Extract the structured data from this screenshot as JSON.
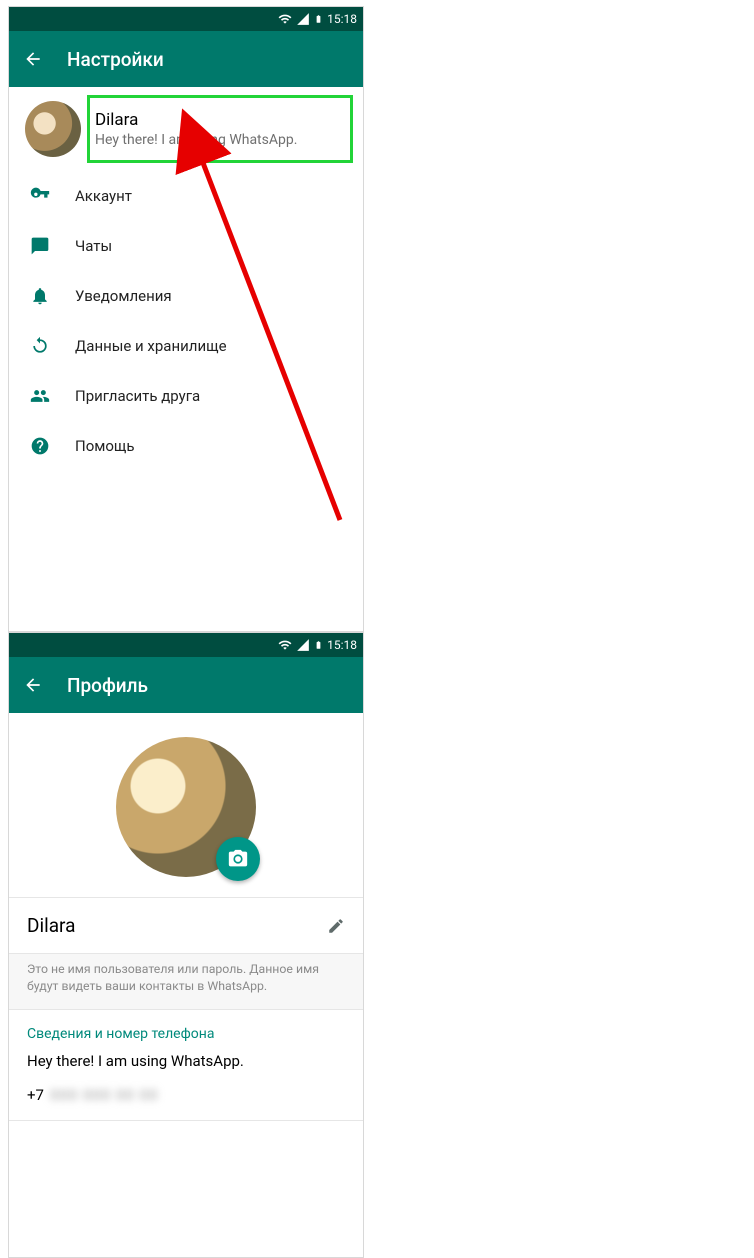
{
  "status": {
    "time": "15:18"
  },
  "left": {
    "title": "Настройки",
    "profile": {
      "name": "Dilara",
      "status": "Hey there! I am using WhatsApp."
    },
    "menu": [
      {
        "icon": "key-icon",
        "label": "Аккаунт"
      },
      {
        "icon": "chat-icon",
        "label": "Чаты"
      },
      {
        "icon": "bell-icon",
        "label": "Уведомления"
      },
      {
        "icon": "data-icon",
        "label": "Данные и хранилище"
      },
      {
        "icon": "invite-icon",
        "label": "Пригласить друга"
      },
      {
        "icon": "help-icon",
        "label": "Помощь"
      }
    ]
  },
  "right": {
    "title": "Профиль",
    "name": "Dilara",
    "hint": "Это не имя пользователя или пароль. Данное имя будут видеть ваши контакты в WhatsApp.",
    "infoTitle": "Сведения и номер телефона",
    "about": "Hey there! I am using WhatsApp.",
    "phonePrefix": "+7",
    "phoneRest": "000 000 00 00"
  }
}
